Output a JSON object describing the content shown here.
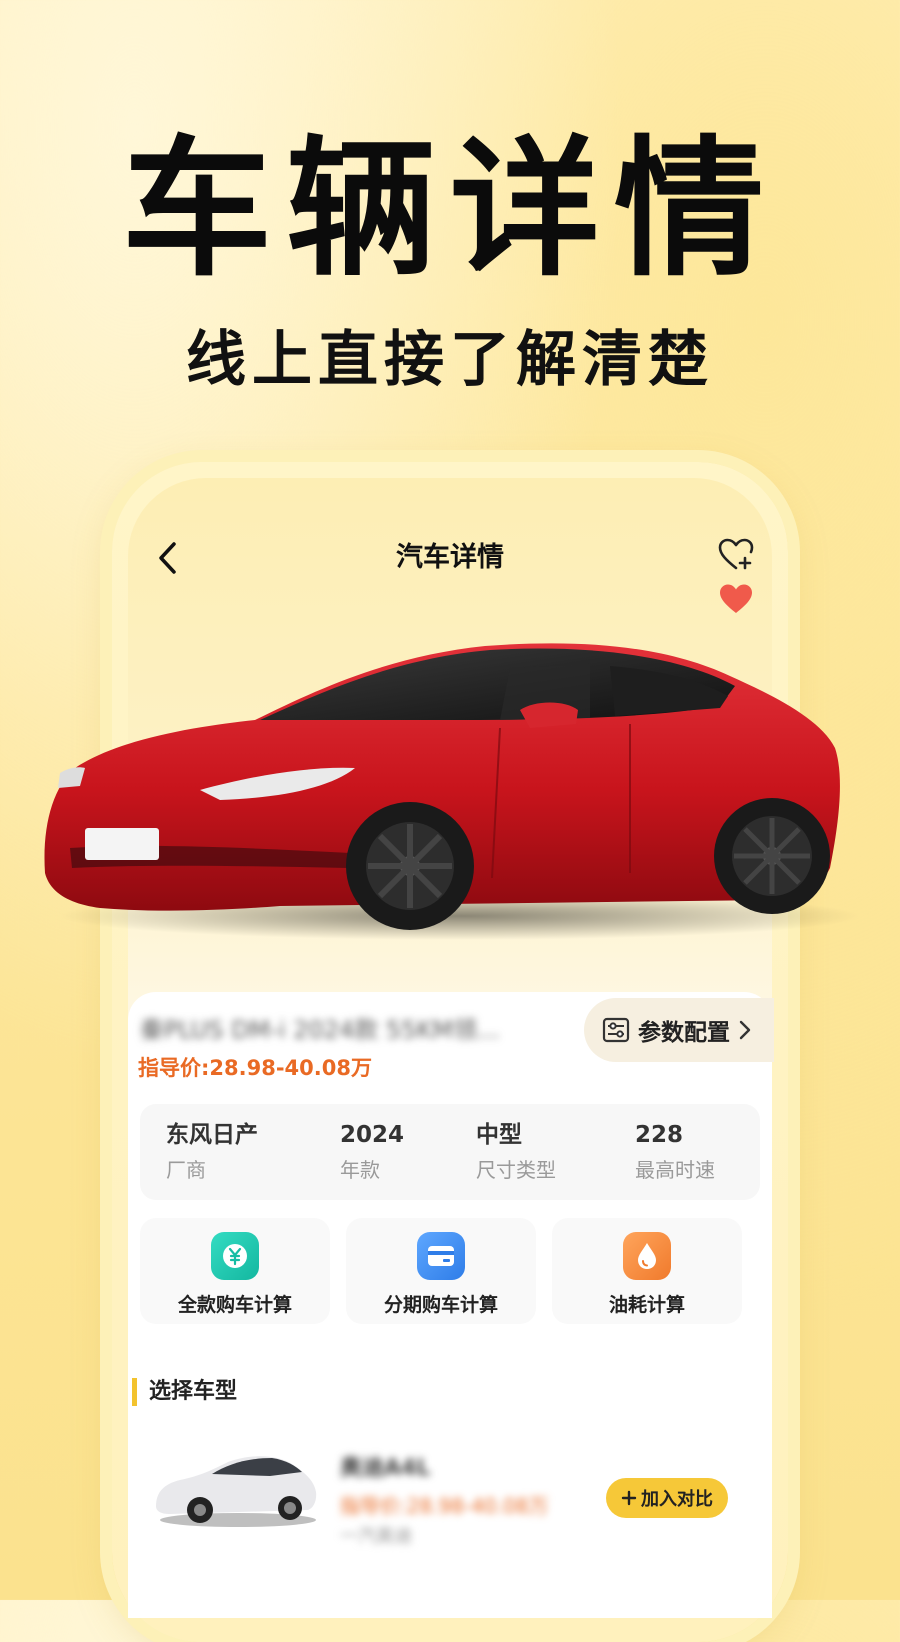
{
  "hero": {
    "title": "车辆详情",
    "subtitle": "线上直接了解清楚"
  },
  "nav": {
    "back_icon": "chevron-left-icon",
    "title": "汽车详情",
    "favorite_add_icon": "heart-plus-icon",
    "favorite_icon": "heart-filled-icon"
  },
  "car": {
    "model_name": "秦PLUS DM-i 2024款 55KM领...",
    "params_label": "参数配置",
    "price_label": "指导价:28.98-40.08万",
    "specs": [
      {
        "value": "东风日产",
        "caption": "厂商"
      },
      {
        "value": "2024",
        "caption": "年款"
      },
      {
        "value": "中型",
        "caption": "尺寸类型"
      },
      {
        "value": "228",
        "caption": "最高时速"
      }
    ]
  },
  "tools": [
    {
      "label": "全款购车计算",
      "icon": "yuan-icon",
      "color": "#1fc9b1"
    },
    {
      "label": "分期购车计算",
      "icon": "card-icon",
      "color": "#3a8cf2"
    },
    {
      "label": "油耗计算",
      "icon": "drop-icon",
      "color": "#f5893d"
    }
  ],
  "variants": {
    "section_title": "选择车型",
    "items": [
      {
        "name": "奥迪A4L",
        "price": "指导价:28.98-40.08万",
        "extra": "一汽奥迪",
        "compare_label": "加入对比"
      }
    ]
  },
  "colors": {
    "accent": "#f6c838",
    "price": "#e96a24",
    "heart": "#f05a4b",
    "car_body": "#c8141c"
  }
}
